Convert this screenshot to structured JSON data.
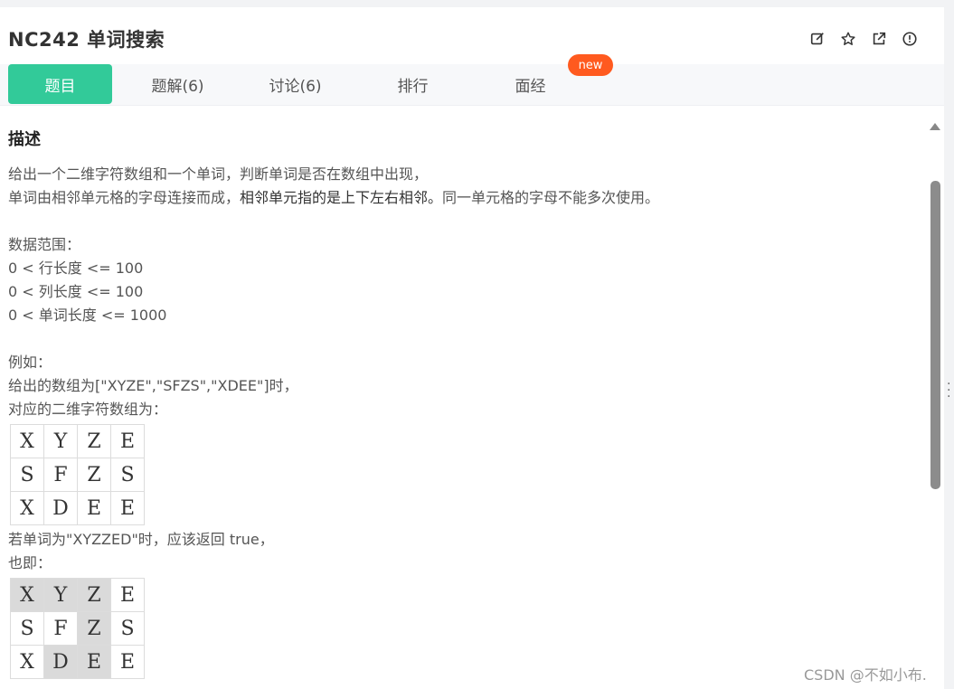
{
  "header": {
    "title": "NC242  单词搜索",
    "actions": [
      "edit-icon",
      "star-icon",
      "external-link-icon",
      "info-icon"
    ]
  },
  "tabs": [
    {
      "label": "题目",
      "active": true
    },
    {
      "label": "题解(6)",
      "active": false
    },
    {
      "label": "讨论(6)",
      "active": false
    },
    {
      "label": "排行",
      "active": false
    },
    {
      "label": "面经",
      "active": false
    }
  ],
  "new_badge": "new",
  "accent_color": "#32ca99",
  "badge_color": "#ff5a1f",
  "content": {
    "heading": "描述",
    "intro_1": "给出一个二维字符数组和一个单词，判断单词是否在数组中出现，",
    "intro_2a": "单词由相邻单元格的字母连接而成，",
    "intro_2b": "相邻单元指的是上下左右相邻。",
    "intro_2c": "同一单元格的字母不能多次使用。",
    "range_title": "数据范围：",
    "range_1": "0 < 行长度 <= 100",
    "range_2": "0 < 列长度 <= 100",
    "range_3": "0 < 单词长度 <= 1000",
    "example_title": "例如：",
    "example_1": "给出的数组为[\"XYZE\",\"SFZS\",\"XDEE\"]时，",
    "example_2": "对应的二维字符数组为：",
    "grid1": [
      [
        "X",
        "Y",
        "Z",
        "E"
      ],
      [
        "S",
        "F",
        "Z",
        "S"
      ],
      [
        "X",
        "D",
        "E",
        "E"
      ]
    ],
    "answer_1": "若单词为\"XYZZED\"时，应该返回 true，",
    "answer_2": "也即：",
    "grid2": [
      [
        "X",
        "Y",
        "Z",
        "E"
      ],
      [
        "S",
        "F",
        "Z",
        "S"
      ],
      [
        "X",
        "D",
        "E",
        "E"
      ]
    ],
    "grid2_highlight": [
      [
        true,
        true,
        true,
        false
      ],
      [
        false,
        false,
        true,
        false
      ],
      [
        false,
        true,
        true,
        false
      ]
    ]
  },
  "watermark": "CSDN @不如小布."
}
